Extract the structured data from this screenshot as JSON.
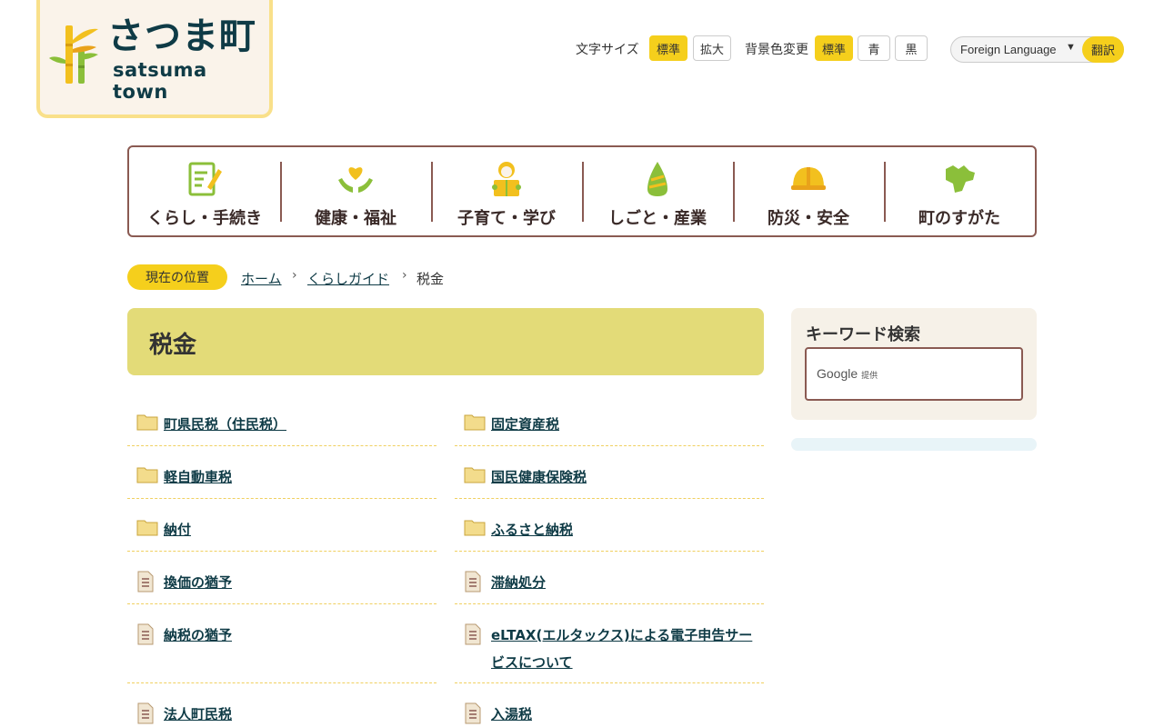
{
  "logo": {
    "title": "さつま町",
    "subtitle": "satsuma town"
  },
  "tools": {
    "font_size_label": "文字サイズ",
    "font_standard": "標準",
    "font_large": "拡大",
    "bg_label": "背景色変更",
    "bg_standard": "標準",
    "bg_blue": "青",
    "bg_black": "黒",
    "language_label": "Foreign Language",
    "language_arrow": "▼",
    "translate_label": "翻訳",
    "accent_color": "#f5cf1c"
  },
  "nav": [
    {
      "label": "くらし・手続き",
      "icon": "form-pen-icon"
    },
    {
      "label": "健康・福祉",
      "icon": "heart-hands-icon"
    },
    {
      "label": "子育て・学び",
      "icon": "child-book-icon"
    },
    {
      "label": "しごと・産業",
      "icon": "bamboo-shoot-icon"
    },
    {
      "label": "防災・安全",
      "icon": "helmet-icon"
    },
    {
      "label": "町のすがた",
      "icon": "town-map-icon"
    }
  ],
  "breadcrumb": {
    "badge": "現在の位置",
    "home": "ホーム",
    "guide": "くらしガイド",
    "current": "税金"
  },
  "page_title": "税金",
  "items": [
    {
      "label": "町県民税（住民税）",
      "icon": "folder-icon"
    },
    {
      "label": "固定資産税",
      "icon": "folder-icon"
    },
    {
      "label": "軽自動車税",
      "icon": "folder-icon"
    },
    {
      "label": "国民健康保険税",
      "icon": "folder-icon"
    },
    {
      "label": "納付",
      "icon": "folder-icon"
    },
    {
      "label": "ふるさと納税",
      "icon": "folder-icon"
    },
    {
      "label": "換価の猶予",
      "icon": "document-icon"
    },
    {
      "label": "滞納処分",
      "icon": "document-icon"
    },
    {
      "label": "納税の猶予",
      "icon": "document-icon"
    },
    {
      "label": "eLTAX(エルタックス)による電子申告サービスについて",
      "icon": "document-icon"
    },
    {
      "label": "法人町民税",
      "icon": "document-icon"
    },
    {
      "label": "入湯税",
      "icon": "document-icon"
    }
  ],
  "sidebar": {
    "search_title": "キーワード検索",
    "search_placeholder_brand": "Google",
    "search_placeholder_suffix": "提供"
  }
}
